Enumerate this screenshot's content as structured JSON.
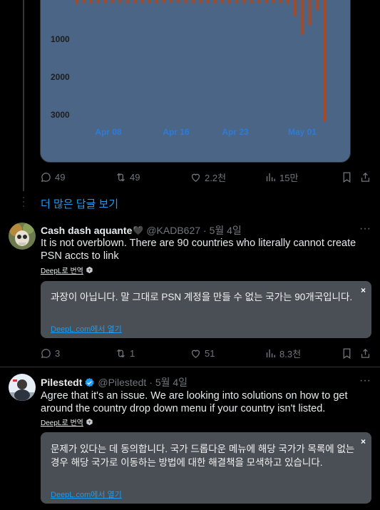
{
  "chart_data": {
    "type": "bar",
    "x_tick_labels": [
      "Apr 08",
      "Apr 16",
      "Apr 23",
      "May 01"
    ],
    "y_tick_labels": [
      "1000",
      "2000",
      "3000"
    ],
    "y_tick_values": [
      1000,
      2000,
      3000
    ],
    "ylim": [
      0,
      3300
    ],
    "values": [
      80,
      60,
      70,
      60,
      70,
      50,
      60,
      70,
      60,
      60,
      60,
      70,
      60,
      50,
      60,
      60,
      70,
      60,
      60,
      70,
      60,
      70,
      60,
      70,
      60,
      70,
      60,
      60,
      60,
      80,
      400,
      900,
      650,
      250,
      3200
    ],
    "colors": {
      "background": "#4a6585",
      "bar": "#a34a28",
      "tick": "#1e1e1e",
      "xtick": "#2e7bd8"
    }
  },
  "top_actions": {
    "reply": "49",
    "retweet": "49",
    "like": "2.2천",
    "views": "15만"
  },
  "more_replies": "더 많은 답글 보기",
  "tweets": [
    {
      "name": "Cash dash aquante",
      "emoji": "🖤",
      "handle": "@KADB627",
      "date": "· 5월 4일",
      "text": "It is not overblown. There are 90 countries who literally cannot create PSN accts to link",
      "deepl_label": "DeepL로 번역",
      "translation": "과장이 아닙니다. 말 그대로 PSN 계정을 만들 수 없는 국가는 90개국입니다.",
      "translation_open": "DeepL.com에서 열기",
      "close_glyph": "×",
      "more_glyph": "···",
      "actions": {
        "reply": "3",
        "retweet": "1",
        "like": "51",
        "views": "8.3천"
      }
    },
    {
      "name": "Pilestedt",
      "handle": "@Pilestedt",
      "date": "· 5월 4일",
      "text": "Agree that it's an issue. We are looking into solutions on how to get around the country drop down menu if your country isn't listed.",
      "deepl_label": "DeepL로 번역",
      "translation": "문제가 있다는 데 동의합니다. 국가 드롭다운 메뉴에 해당 국가가 목록에 없는 경우 해당 국가로 이동하는 방법에 대한 해결책을 모색하고 있습니다.",
      "translation_open": "DeepL.com에서 열기",
      "close_glyph": "×",
      "more_glyph": "···"
    }
  ],
  "colors": {
    "link": "#1d9bf0",
    "muted": "#71767b",
    "verified": "#1d9bf0"
  }
}
